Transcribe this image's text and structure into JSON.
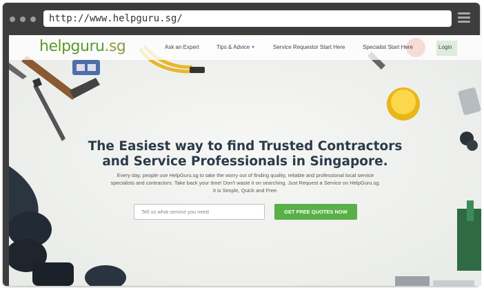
{
  "browser": {
    "url": "http://www.helpguru.sg/",
    "menu_icon": "hamburger-menu-icon"
  },
  "site": {
    "logo_part1": "helpguru",
    "logo_part2": ".sg"
  },
  "nav": {
    "items": [
      "Ask an Expert",
      "Tips & Advice",
      "Service Requestor Start Here",
      "Specialist Start Here",
      "Login"
    ],
    "dropdown_icon": "chevron-down-icon"
  },
  "hero": {
    "headline_line1": "The Easiest way to find Trusted Contractors",
    "headline_line2": "and Service Professionals in Singapore.",
    "sub_line1": "Every day, people use HelpGuru.sg to take the worry out of finding quality, reliable and professional local service",
    "sub_line2": "specialists and contractors. Take back your time! Don't waste it on searching. Just Request a Service on HelpGuru.sg.",
    "sub_line3": "It is Simple, Quick and Free.",
    "search_placeholder": "Tell us what service you need",
    "cta_label": "GET FREE QUOTES NOW"
  },
  "colors": {
    "browser_chrome": "#3d3d3d",
    "logo_green": "#5a9a2c",
    "cta_green": "#58b046",
    "headline": "#2a3b4a"
  }
}
